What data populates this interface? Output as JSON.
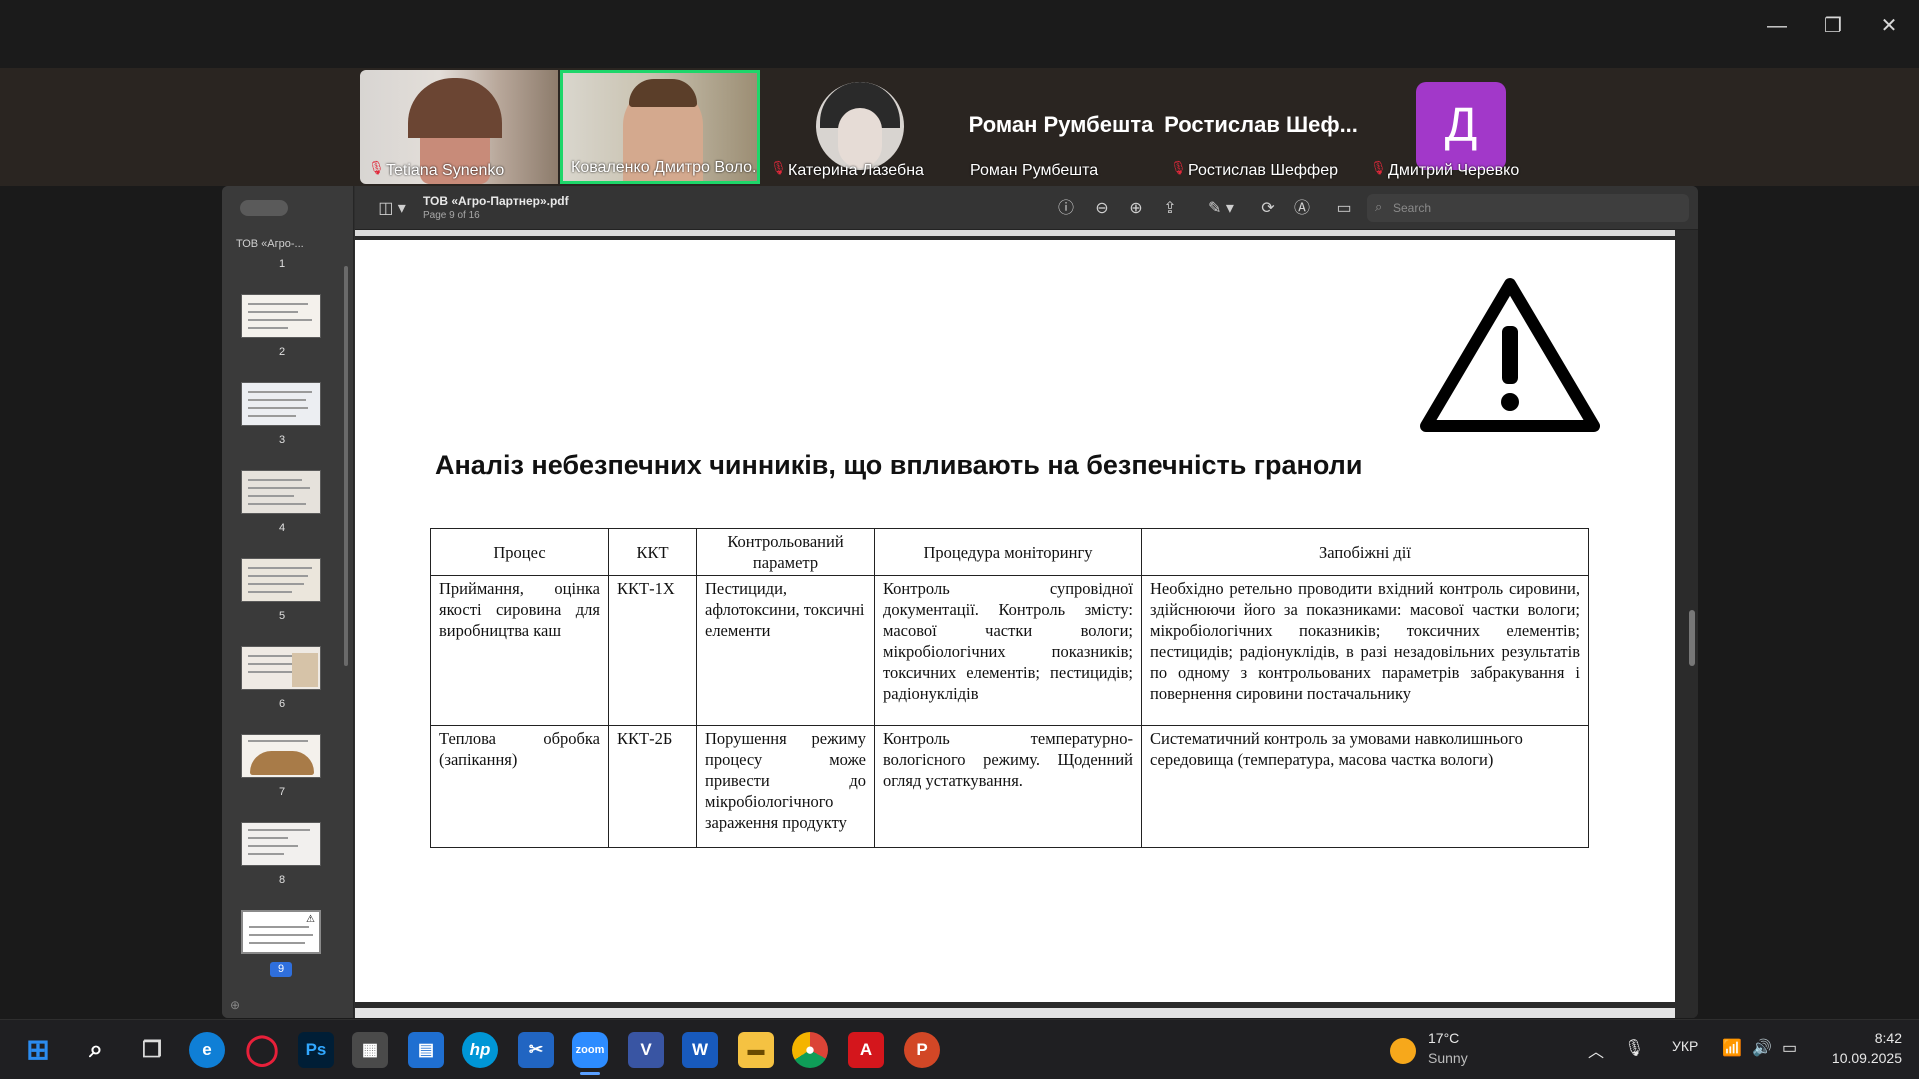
{
  "zoom": {
    "participants": [
      {
        "name": "Tetiana Synenko",
        "muted": true
      },
      {
        "name": "Коваленко Дмитро Воло...",
        "muted": false,
        "active_speaker": true
      },
      {
        "name": "Катерина Лазебна",
        "muted": true
      },
      {
        "name": "Роман Румбешта",
        "muted": false,
        "big_label": "Роман Румбешта"
      },
      {
        "name": "Ростислав Шеффер",
        "muted": true,
        "big_label": "Ростислав Шеф..."
      },
      {
        "name": "Дмитрий Черевко",
        "muted": true,
        "avatar_letter": "Д"
      }
    ]
  },
  "preview": {
    "file_name": "ТОВ «Агро-Партнер».pdf",
    "page_info": "Page 9 of 16",
    "search_placeholder": "Search",
    "sidebar_first_label": "ТОВ «Агро-...",
    "thumbnails": [
      "1",
      "2",
      "3",
      "4",
      "5",
      "6",
      "7",
      "8",
      "9"
    ],
    "current_page": "9"
  },
  "slide": {
    "title": "Аналіз небезпечних чинників, що впливають на безпечність граноли",
    "warning_icon": "warning-triangle-icon",
    "table": {
      "headers": [
        "Процес",
        "ККТ",
        "Контрольований параметр",
        "Процедура моніторингу",
        "Запобіжні дії"
      ],
      "rows": [
        [
          "Приймання, оцінка якості сировина для виробництва каш",
          "ККТ-1Х",
          "Пестициди, афлотоксини, токсичні елементи",
          "Контроль супровідної документації. Контроль змісту: масової частки вологи; мікробіологічних показників; токсичних елементів; пестицидів; радіонуклідів",
          "Необхідно ретельно проводити вхідний контроль сировини, здійснюючи його за показниками: масової частки вологи; мікробіологічних показників; токсичних елементів; пестицидів; радіонуклідів, в разі незадовільних результатів по одному з контрольованих параметрів забракування і повернення сировини постачальнику"
        ],
        [
          "Теплова обробка (запікання)",
          "ККТ-2Б",
          "Порушення режиму процесу може привести до мікробіологічного зараження продукту",
          "Контроль температурно-вологісного режиму. Щоденний огляд устаткування.",
          "Систематичний контроль за умовами навколишнього середовища (температура, масова частка вологи)"
        ]
      ]
    }
  },
  "taskbar": {
    "weather_temp": "17°C",
    "weather_desc": "Sunny",
    "language": "УКР",
    "time": "8:42",
    "date": "10.09.2025",
    "apps": [
      "start-icon",
      "search-icon",
      "task-view-icon",
      "edge-icon",
      "opera-icon",
      "photoshop-icon",
      "calculator-icon",
      "store-icon",
      "hp-icon",
      "snipping-icon",
      "zoom-icon",
      "visio-icon",
      "word-icon",
      "explorer-icon",
      "chrome-icon",
      "acrobat-icon",
      "powerpoint-icon"
    ]
  },
  "colors": {
    "active_speaker_border": "#1ed66a",
    "mute_red": "#e0283a",
    "avatar_purple": "#a238c9",
    "selected_page": "#2f6fdc"
  }
}
